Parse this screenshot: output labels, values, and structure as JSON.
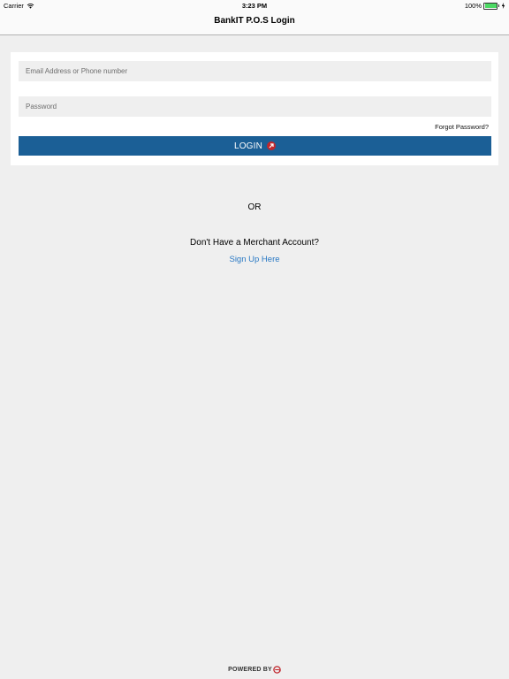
{
  "status_bar": {
    "carrier": "Carrier",
    "time": "3:23 PM",
    "battery": "100%",
    "battery_level": 1.0,
    "icons": [
      "wifi-icon",
      "battery-icon",
      "charging-icon"
    ]
  },
  "nav": {
    "title": "BankIT P.O.S Login"
  },
  "login_form": {
    "email_placeholder": "Email Address or Phone number",
    "email_value": "",
    "password_placeholder": "Password",
    "password_value": "",
    "forgot_label": "Forgot Password?",
    "login_label": "LOGIN",
    "login_icon": "arrow-up-right-circle-icon"
  },
  "alt": {
    "or_label": "OR",
    "question": "Don't Have a Merchant Account?",
    "signup_label": "Sign Up Here"
  },
  "footer": {
    "powered_label": "POWERED BY",
    "logo": "brand-logo-icon"
  },
  "colors": {
    "background": "#efefef",
    "primary_button": "#1b5f96",
    "link": "#2a79c4",
    "accent_red": "#c0272d",
    "battery_green": "#4cd964"
  }
}
